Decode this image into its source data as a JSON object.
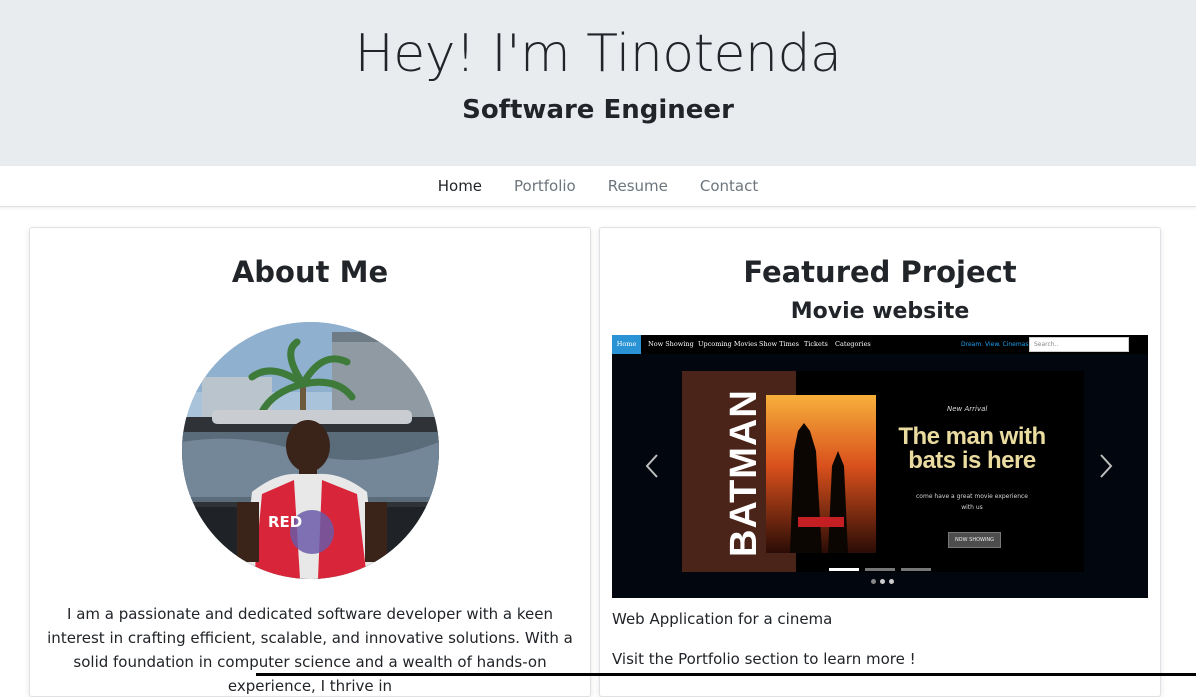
{
  "header": {
    "title": "Hey! I'm Tinotenda",
    "subtitle": "Software Engineer"
  },
  "nav": {
    "items": [
      {
        "label": "Home",
        "active": true
      },
      {
        "label": "Portfolio",
        "active": false
      },
      {
        "label": "Resume",
        "active": false
      },
      {
        "label": "Contact",
        "active": false
      }
    ]
  },
  "about": {
    "title": "About Me",
    "photo_icon": "profile-photo",
    "text": "I am a passionate and dedicated software developer with a keen interest in crafting efficient, scalable, and innovative solutions. With a solid foundation in computer science and a wealth of hands-on experience, I thrive in"
  },
  "featured": {
    "title": "Featured Project",
    "subtitle": "Movie website",
    "screenshot": {
      "nav_items": [
        "Home",
        "Now Showing",
        "Upcoming Movies",
        "Show Times",
        "Tickets",
        "Categories"
      ],
      "brand": "Dream. View. Cinemas",
      "search_placeholder": "Search..",
      "poster_text": "BATMAN",
      "new_arrival": "New Arrival",
      "headline": "The man with bats is here",
      "tagline": "come have a great movie experience with us",
      "cta": "NOW SHOWING",
      "accent_color": "#2a93d5",
      "headline_color": "#eadb9f",
      "poster_color": "#4a2419"
    },
    "description": "Web Application for a cinema",
    "more": "Visit the Portfolio section to learn more !"
  },
  "colors": {
    "header_bg": "#e9ecef",
    "text": "#212529",
    "muted_nav": "#6c757d"
  }
}
